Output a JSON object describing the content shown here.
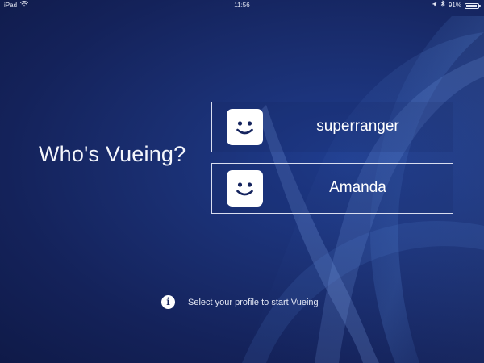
{
  "status_bar": {
    "device": "iPad",
    "wifi_icon": "wifi-icon",
    "time": "11:56",
    "location_icon": "location-arrow-icon",
    "bluetooth_icon": "bluetooth-icon",
    "battery_text": "91%",
    "battery_level": 0.91
  },
  "title": "Who's Vueing?",
  "profiles": [
    {
      "name": "superranger",
      "avatar_icon": "smiley-face-icon"
    },
    {
      "name": "Amanda",
      "avatar_icon": "smiley-face-icon"
    }
  ],
  "hint": {
    "icon": "info-icon",
    "text": "Select your profile to start Vueing"
  },
  "colors": {
    "background": "#1a2f72",
    "border": "#d9def0",
    "text": "#ffffff"
  }
}
